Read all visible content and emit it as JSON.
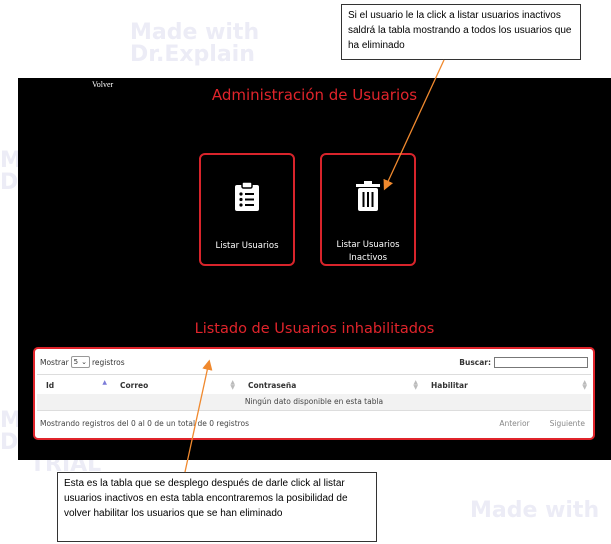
{
  "watermark": {
    "line1": "Made with",
    "line2": "Dr.Explain",
    "line3": "TRIAL",
    "color": "#ececf6"
  },
  "screen": {
    "back_label": "Volver",
    "admin_title": "Administración de Usuarios",
    "accent": "#e0242b",
    "cards": [
      {
        "label": "Listar Usuarios",
        "icon": "clipboard-list-icon"
      },
      {
        "label_line1": "Listar Usuarios",
        "label_line2": "Inactivos",
        "icon": "trash-icon"
      }
    ],
    "list_title": "Listado de Usuarios inhabilitados",
    "table": {
      "show_label": "Mostrar",
      "page_size": "5",
      "records_label": "registros",
      "search_label": "Buscar:",
      "search_value": "",
      "columns": [
        "Id",
        "Correo",
        "Contraseña",
        "Habilitar"
      ],
      "empty_text": "Ningún dato disponible en esta tabla",
      "info_text": "Mostrando registros del 0 al 0 de un total de 0 registros",
      "prev_label": "Anterior",
      "next_label": "Siguiente"
    }
  },
  "annotations": {
    "top": "Si el usuario le la click a listar usuarios inactivos saldrá la tabla mostrando a todos los usuarios que ha eliminado",
    "bottom": "Esta es la tabla que se desplego después de darle click al listar usuarios inactivos en esta tabla encontraremos la posibilidad de volver habilitar los usuarios que se han eliminado",
    "arrow_color": "#f0892e"
  }
}
